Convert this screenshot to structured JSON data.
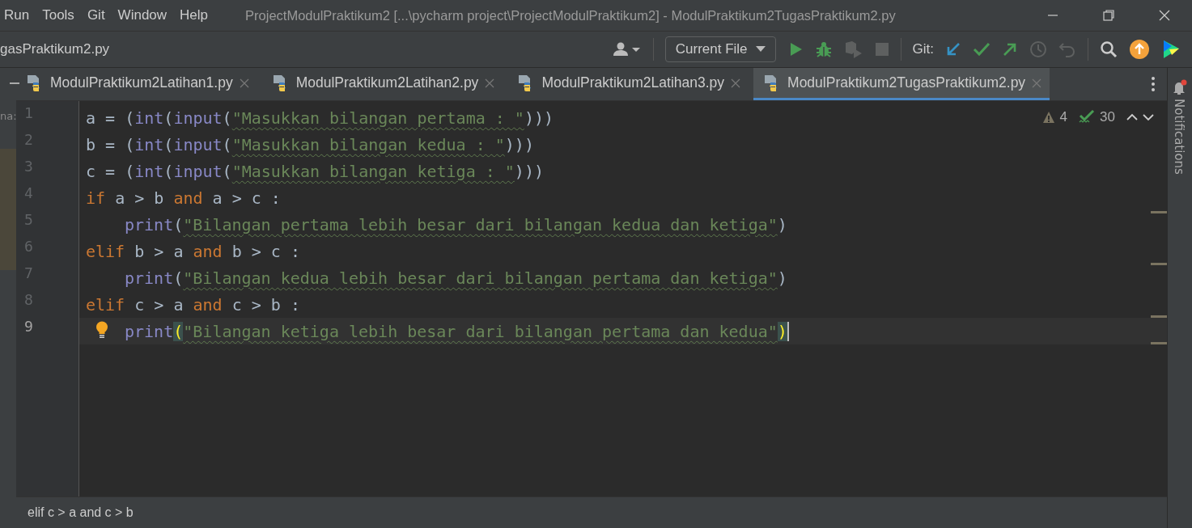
{
  "menu": [
    "Run",
    "Tools",
    "Git",
    "Window",
    "Help"
  ],
  "window": {
    "title": "ProjectModulPraktikum2 [...\\pycharm project\\ProjectModulPraktikum2] - ModulPraktikum2TugasPraktikum2.py"
  },
  "toolbar": {
    "breadcrumb": "gasPraktikum2.py",
    "run_config": "Current File",
    "git_label": "Git:"
  },
  "tabs": [
    {
      "label": "ModulPraktikum2Latihan1.py",
      "selected": false
    },
    {
      "label": "ModulPraktikum2Latihan2.py",
      "selected": false
    },
    {
      "label": "ModulPraktikum2Latihan3.py",
      "selected": false
    },
    {
      "label": "ModulPraktikum2TugasPraktikum2.py",
      "selected": true
    }
  ],
  "project_panel_fragment": "na:",
  "inspections": {
    "warnings": "4",
    "typos": "30"
  },
  "lines": [
    {
      "number": "1",
      "indented": false,
      "current": false,
      "tokens": [
        {
          "kind": "plain",
          "text": "a = ("
        },
        {
          "kind": "builtin",
          "text": "int"
        },
        {
          "kind": "plain",
          "text": "("
        },
        {
          "kind": "builtin",
          "text": "input"
        },
        {
          "kind": "plain",
          "text": "("
        },
        {
          "kind": "string",
          "text": "\"Masukkan bilangan pertama : \""
        },
        {
          "kind": "plain",
          "text": ")))"
        }
      ]
    },
    {
      "number": "2",
      "indented": false,
      "current": false,
      "tokens": [
        {
          "kind": "plain",
          "text": "b = ("
        },
        {
          "kind": "builtin",
          "text": "int"
        },
        {
          "kind": "plain",
          "text": "("
        },
        {
          "kind": "builtin",
          "text": "input"
        },
        {
          "kind": "plain",
          "text": "("
        },
        {
          "kind": "string",
          "text": "\"Masukkan bilangan kedua : \""
        },
        {
          "kind": "plain",
          "text": ")))"
        }
      ]
    },
    {
      "number": "3",
      "indented": false,
      "current": false,
      "tokens": [
        {
          "kind": "plain",
          "text": "c = ("
        },
        {
          "kind": "builtin",
          "text": "int"
        },
        {
          "kind": "plain",
          "text": "("
        },
        {
          "kind": "builtin",
          "text": "input"
        },
        {
          "kind": "plain",
          "text": "("
        },
        {
          "kind": "string",
          "text": "\"Masukkan bilangan ketiga : \""
        },
        {
          "kind": "plain",
          "text": ")))"
        }
      ]
    },
    {
      "number": "4",
      "indented": false,
      "current": false,
      "tokens": [
        {
          "kind": "keyword",
          "text": "if"
        },
        {
          "kind": "plain",
          "text": " a > b "
        },
        {
          "kind": "keyword",
          "text": "and"
        },
        {
          "kind": "plain",
          "text": " a > c :"
        }
      ]
    },
    {
      "number": "5",
      "indented": true,
      "current": false,
      "tokens": [
        {
          "kind": "builtin",
          "text": "print"
        },
        {
          "kind": "plain",
          "text": "("
        },
        {
          "kind": "string",
          "text": "\"Bilangan pertama lebih besar dari bilangan kedua dan ketiga\""
        },
        {
          "kind": "plain",
          "text": ")"
        }
      ]
    },
    {
      "number": "6",
      "indented": false,
      "current": false,
      "tokens": [
        {
          "kind": "keyword",
          "text": "elif"
        },
        {
          "kind": "plain",
          "text": " b > a "
        },
        {
          "kind": "keyword",
          "text": "and"
        },
        {
          "kind": "plain",
          "text": " b > c :"
        }
      ]
    },
    {
      "number": "7",
      "indented": true,
      "current": false,
      "tokens": [
        {
          "kind": "builtin",
          "text": "print"
        },
        {
          "kind": "plain",
          "text": "("
        },
        {
          "kind": "string",
          "text": "\"Bilangan kedua lebih besar dari bilangan pertama dan ketiga\""
        },
        {
          "kind": "plain",
          "text": ")"
        }
      ]
    },
    {
      "number": "8",
      "indented": false,
      "current": false,
      "tokens": [
        {
          "kind": "keyword",
          "text": "elif"
        },
        {
          "kind": "plain",
          "text": " c > a "
        },
        {
          "kind": "keyword",
          "text": "and"
        },
        {
          "kind": "plain",
          "text": " c > b :"
        }
      ]
    },
    {
      "number": "9",
      "indented": true,
      "current": true,
      "tokens": [
        {
          "kind": "builtin",
          "text": "print"
        },
        {
          "kind": "bracket",
          "text": "("
        },
        {
          "kind": "string",
          "text": "\"Bilangan ketiga lebih besar dari bilangan pertama dan kedua\""
        },
        {
          "kind": "bracket",
          "text": ")"
        }
      ]
    }
  ],
  "status_breadcrumb": "elif c > a and c > b",
  "notifications": {
    "label": "Notifications",
    "unread": true
  }
}
